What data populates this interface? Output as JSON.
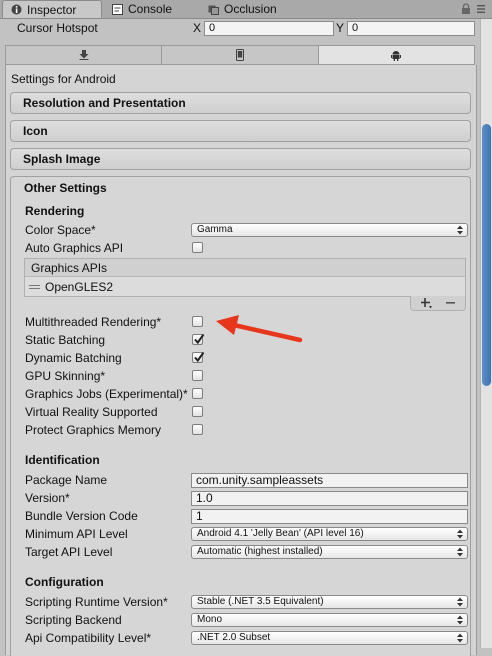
{
  "tabs": [
    {
      "label": "Inspector",
      "icon": "info-icon",
      "active": true
    },
    {
      "label": "Console",
      "icon": "console-icon",
      "active": false
    },
    {
      "label": "Occlusion",
      "icon": "occlusion-icon",
      "active": false
    }
  ],
  "cursor_hotspot": {
    "label": "Cursor Hotspot",
    "x_label": "X",
    "x_value": "0",
    "y_label": "Y",
    "y_value": "0"
  },
  "platform_tabs": [
    "download-icon",
    "mobile-icon",
    "android-icon"
  ],
  "settings_title": "Settings for Android",
  "sections": {
    "resolution": "Resolution and Presentation",
    "icon": "Icon",
    "splash": "Splash Image",
    "other": "Other Settings"
  },
  "rendering": {
    "header": "Rendering",
    "color_space_label": "Color Space*",
    "color_space_value": "Gamma",
    "auto_graphics_api_label": "Auto Graphics API",
    "graphics_apis_label": "Graphics APIs",
    "graphics_apis": [
      "OpenGLES2"
    ],
    "checkboxes": [
      {
        "label": "Multithreaded Rendering*",
        "checked": false
      },
      {
        "label": "Static Batching",
        "checked": true
      },
      {
        "label": "Dynamic Batching",
        "checked": true
      },
      {
        "label": "GPU Skinning*",
        "checked": false
      },
      {
        "label": "Graphics Jobs (Experimental)*",
        "checked": false
      },
      {
        "label": "Virtual Reality Supported",
        "checked": false
      },
      {
        "label": "Protect Graphics Memory",
        "checked": false
      }
    ]
  },
  "identification": {
    "header": "Identification",
    "package_name_label": "Package Name",
    "package_name_value": "com.unity.sampleassets",
    "version_label": "Version*",
    "version_value": "1.0",
    "bundle_version_label": "Bundle Version Code",
    "bundle_version_value": "1",
    "min_api_label": "Minimum API Level",
    "min_api_value": "Android 4.1 'Jelly Bean' (API level 16)",
    "target_api_label": "Target API Level",
    "target_api_value": "Automatic (highest installed)"
  },
  "configuration": {
    "header": "Configuration",
    "runtime_label": "Scripting Runtime Version*",
    "runtime_value": "Stable (.NET 3.5 Equivalent)",
    "backend_label": "Scripting Backend",
    "backend_value": "Mono",
    "api_compat_label": "Api Compatibility Level*",
    "api_compat_value": ".NET 2.0 Subset"
  },
  "colors": {
    "annotation_arrow": "#e8361c",
    "scroll_thumb": "#4a7fbf"
  }
}
